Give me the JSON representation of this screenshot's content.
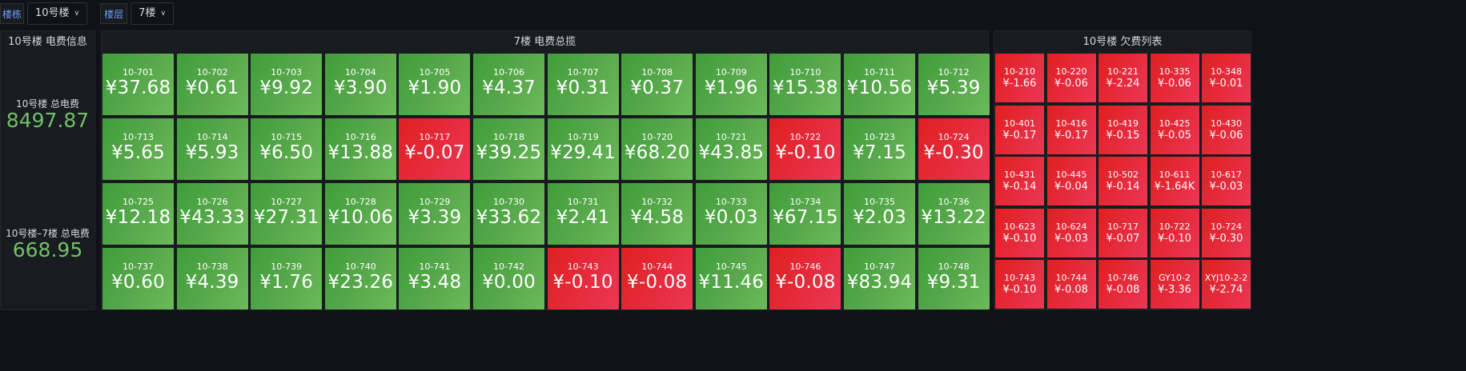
{
  "variables": {
    "building_label": "楼栋",
    "building_value": "10号楼",
    "floor_label": "楼层",
    "floor_value": "7楼"
  },
  "info_panel": {
    "title": "10号楼 电费信息",
    "total_label": "10号楼 总电费",
    "total_value": "8497.87",
    "floor_total_label": "10号楼–7楼 总电费",
    "floor_total_value": "668.95"
  },
  "overview_panel": {
    "title": "7楼 电费总揽",
    "rooms": [
      {
        "room": "10-701",
        "value": "¥37.68",
        "status": "ok"
      },
      {
        "room": "10-702",
        "value": "¥0.61",
        "status": "ok"
      },
      {
        "room": "10-703",
        "value": "¥9.92",
        "status": "ok"
      },
      {
        "room": "10-704",
        "value": "¥3.90",
        "status": "ok"
      },
      {
        "room": "10-705",
        "value": "¥1.90",
        "status": "ok"
      },
      {
        "room": "10-706",
        "value": "¥4.37",
        "status": "ok"
      },
      {
        "room": "10-707",
        "value": "¥0.31",
        "status": "ok"
      },
      {
        "room": "10-708",
        "value": "¥0.37",
        "status": "ok"
      },
      {
        "room": "10-709",
        "value": "¥1.96",
        "status": "ok"
      },
      {
        "room": "10-710",
        "value": "¥15.38",
        "status": "ok"
      },
      {
        "room": "10-711",
        "value": "¥10.56",
        "status": "ok"
      },
      {
        "room": "10-712",
        "value": "¥5.39",
        "status": "ok"
      },
      {
        "room": "10-713",
        "value": "¥5.65",
        "status": "ok"
      },
      {
        "room": "10-714",
        "value": "¥5.93",
        "status": "ok"
      },
      {
        "room": "10-715",
        "value": "¥6.50",
        "status": "ok"
      },
      {
        "room": "10-716",
        "value": "¥13.88",
        "status": "ok"
      },
      {
        "room": "10-717",
        "value": "¥-0.07",
        "status": "owing"
      },
      {
        "room": "10-718",
        "value": "¥39.25",
        "status": "ok"
      },
      {
        "room": "10-719",
        "value": "¥29.41",
        "status": "ok"
      },
      {
        "room": "10-720",
        "value": "¥68.20",
        "status": "ok"
      },
      {
        "room": "10-721",
        "value": "¥43.85",
        "status": "ok"
      },
      {
        "room": "10-722",
        "value": "¥-0.10",
        "status": "owing"
      },
      {
        "room": "10-723",
        "value": "¥7.15",
        "status": "ok"
      },
      {
        "room": "10-724",
        "value": "¥-0.30",
        "status": "owing"
      },
      {
        "room": "10-725",
        "value": "¥12.18",
        "status": "ok"
      },
      {
        "room": "10-726",
        "value": "¥43.33",
        "status": "ok"
      },
      {
        "room": "10-727",
        "value": "¥27.31",
        "status": "ok"
      },
      {
        "room": "10-728",
        "value": "¥10.06",
        "status": "ok"
      },
      {
        "room": "10-729",
        "value": "¥3.39",
        "status": "ok"
      },
      {
        "room": "10-730",
        "value": "¥33.62",
        "status": "ok"
      },
      {
        "room": "10-731",
        "value": "¥2.41",
        "status": "ok"
      },
      {
        "room": "10-732",
        "value": "¥4.58",
        "status": "ok"
      },
      {
        "room": "10-733",
        "value": "¥0.03",
        "status": "ok"
      },
      {
        "room": "10-734",
        "value": "¥67.15",
        "status": "ok"
      },
      {
        "room": "10-735",
        "value": "¥2.03",
        "status": "ok"
      },
      {
        "room": "10-736",
        "value": "¥13.22",
        "status": "ok"
      },
      {
        "room": "10-737",
        "value": "¥0.60",
        "status": "ok"
      },
      {
        "room": "10-738",
        "value": "¥4.39",
        "status": "ok"
      },
      {
        "room": "10-739",
        "value": "¥1.76",
        "status": "ok"
      },
      {
        "room": "10-740",
        "value": "¥23.26",
        "status": "ok"
      },
      {
        "room": "10-741",
        "value": "¥3.48",
        "status": "ok"
      },
      {
        "room": "10-742",
        "value": "¥0.00",
        "status": "ok"
      },
      {
        "room": "10-743",
        "value": "¥-0.10",
        "status": "owing"
      },
      {
        "room": "10-744",
        "value": "¥-0.08",
        "status": "owing"
      },
      {
        "room": "10-745",
        "value": "¥11.46",
        "status": "ok"
      },
      {
        "room": "10-746",
        "value": "¥-0.08",
        "status": "owing"
      },
      {
        "room": "10-747",
        "value": "¥83.94",
        "status": "ok"
      },
      {
        "room": "10-748",
        "value": "¥9.31",
        "status": "ok"
      }
    ]
  },
  "arrears_panel": {
    "title": "10号楼 欠费列表",
    "rooms": [
      {
        "room": "10-210",
        "value": "¥-1.66"
      },
      {
        "room": "10-220",
        "value": "¥-0.06"
      },
      {
        "room": "10-221",
        "value": "¥-2.24"
      },
      {
        "room": "10-335",
        "value": "¥-0.06"
      },
      {
        "room": "10-348",
        "value": "¥-0.01"
      },
      {
        "room": "10-401",
        "value": "¥-0.17"
      },
      {
        "room": "10-416",
        "value": "¥-0.17"
      },
      {
        "room": "10-419",
        "value": "¥-0.15"
      },
      {
        "room": "10-425",
        "value": "¥-0.05"
      },
      {
        "room": "10-430",
        "value": "¥-0.06"
      },
      {
        "room": "10-431",
        "value": "¥-0.14"
      },
      {
        "room": "10-445",
        "value": "¥-0.04"
      },
      {
        "room": "10-502",
        "value": "¥-0.14"
      },
      {
        "room": "10-611",
        "value": "¥-1.64K"
      },
      {
        "room": "10-617",
        "value": "¥-0.03"
      },
      {
        "room": "10-623",
        "value": "¥-0.10"
      },
      {
        "room": "10-624",
        "value": "¥-0.03"
      },
      {
        "room": "10-717",
        "value": "¥-0.07"
      },
      {
        "room": "10-722",
        "value": "¥-0.10"
      },
      {
        "room": "10-724",
        "value": "¥-0.30"
      },
      {
        "room": "10-743",
        "value": "¥-0.10"
      },
      {
        "room": "10-744",
        "value": "¥-0.08"
      },
      {
        "room": "10-746",
        "value": "¥-0.08"
      },
      {
        "room": "GY10-2",
        "value": "¥-3.36"
      },
      {
        "room": "XYJ10-2-2",
        "value": "¥-2.74"
      }
    ]
  },
  "colors": {
    "ok": "#56a84a",
    "owing": "#e52a3a",
    "stat_value": "#73bf69",
    "variable_label": "#6e9fff"
  }
}
